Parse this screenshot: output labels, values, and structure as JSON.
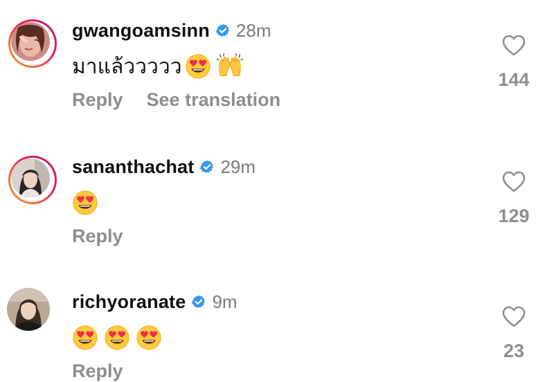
{
  "colors": {
    "text": "#111111",
    "muted": "#8e8e8e",
    "time": "#7a7a7a",
    "verified": "#3897f0",
    "story_ring_start": "#f9a825",
    "story_ring_end": "#e91e63"
  },
  "comments": [
    {
      "username": "gwangoamsinn",
      "verified": true,
      "time": "28m",
      "text": "มาแล้ววววว",
      "emojis": [
        "heart-eyes-emoji",
        "raising-hands-emoji"
      ],
      "actions": [
        "Reply",
        "See translation"
      ],
      "likes": "144",
      "story_ring": true
    },
    {
      "username": "sananthachat",
      "verified": true,
      "time": "29m",
      "text": "",
      "emojis": [
        "heart-eyes-emoji"
      ],
      "actions": [
        "Reply"
      ],
      "likes": "129",
      "story_ring": true
    },
    {
      "username": "richyoranate",
      "verified": true,
      "time": "9m",
      "text": "",
      "emojis": [
        "heart-eyes-emoji",
        "heart-eyes-emoji",
        "heart-eyes-emoji"
      ],
      "actions": [
        "Reply"
      ],
      "likes": "23",
      "story_ring": false
    }
  ]
}
